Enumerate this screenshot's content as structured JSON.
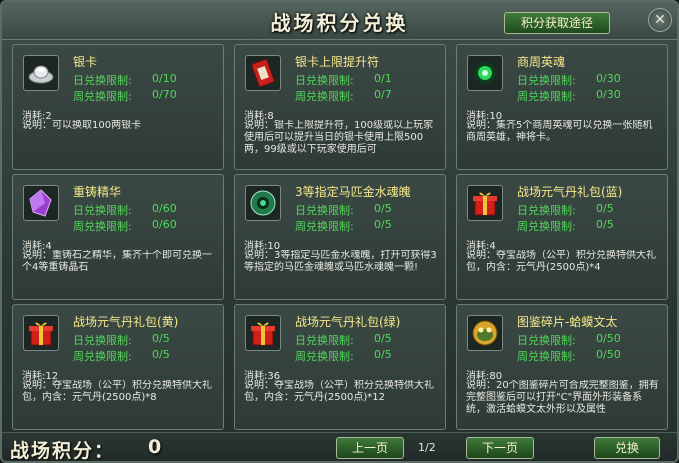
{
  "window": {
    "title": "战场积分兑换",
    "route_button": "积分获取途径",
    "close_glyph": "✕"
  },
  "items": [
    {
      "name": "银卡",
      "icon": "silver-ingot-icon",
      "daily_label": "日兑换限制:",
      "daily_value": "0/10",
      "weekly_label": "周兑换限制:",
      "weekly_value": "0/70",
      "cost": "消耗:2",
      "desc": "说明：可以换取100两银卡"
    },
    {
      "name": "银卡上限提升符",
      "icon": "red-talisman-icon",
      "daily_label": "日兑换限制:",
      "daily_value": "0/1",
      "weekly_label": "周兑换限制:",
      "weekly_value": "0/7",
      "cost": "消耗:8",
      "desc": "说明：银卡上限提升符，100级或以上玩家使用后可以提升当日的银卡使用上限500两，99级或以下玩家使用后可"
    },
    {
      "name": "商周英魂",
      "icon": "green-soul-orb-icon",
      "daily_label": "日兑换限制:",
      "daily_value": "0/30",
      "weekly_label": "周兑换限制:",
      "weekly_value": "0/30",
      "cost": "消耗:10",
      "desc": "说明：集齐5个商周英魂可以兑换一张随机商周英雄，神将卡。"
    },
    {
      "name": "重铸精华",
      "icon": "purple-crystal-icon",
      "daily_label": "日兑换限制:",
      "daily_value": "0/60",
      "weekly_label": "周兑换限制:",
      "weekly_value": "0/60",
      "cost": "消耗:4",
      "desc": "说明：重铸石之精华，集齐十个即可兑换一个4等重铸晶石"
    },
    {
      "name": "3等指定马匹金水魂魄",
      "icon": "jade-disc-icon",
      "daily_label": "日兑换限制:",
      "daily_value": "0/5",
      "weekly_label": "周兑换限制:",
      "weekly_value": "0/5",
      "cost": "消耗:10",
      "desc": "说明：3等指定马匹金水魂魄，打开可获得3等指定的马匹金魂魄或马匹水魂魄一颗!"
    },
    {
      "name": "战场元气丹礼包(蓝)",
      "icon": "gift-box-icon",
      "daily_label": "日兑换限制:",
      "daily_value": "0/5",
      "weekly_label": "周兑换限制:",
      "weekly_value": "0/5",
      "cost": "消耗:4",
      "desc": "说明：夺宝战场（公平）积分兑换特供大礼包，内含：元气丹(2500点)*4"
    },
    {
      "name": "战场元气丹礼包(黄)",
      "icon": "gift-box-icon",
      "daily_label": "日兑换限制:",
      "daily_value": "0/5",
      "weekly_label": "周兑换限制:",
      "weekly_value": "0/5",
      "cost": "消耗:12",
      "desc": "说明：夺宝战场（公平）积分兑换特供大礼包，内含：元气丹(2500点)*8"
    },
    {
      "name": "战场元气丹礼包(绿)",
      "icon": "gift-box-icon",
      "daily_label": "日兑换限制:",
      "daily_value": "0/5",
      "weekly_label": "周兑换限制:",
      "weekly_value": "0/5",
      "cost": "消耗:36",
      "desc": "说明：夺宝战场（公平）积分兑换特供大礼包，内含：元气丹(2500点)*12"
    },
    {
      "name": "图鉴碎片-蛤蟆文太",
      "icon": "toad-fragment-icon",
      "daily_label": "日兑换限制:",
      "daily_value": "0/50",
      "weekly_label": "周兑换限制:",
      "weekly_value": "0/50",
      "cost": "消耗:80",
      "desc": "说明：20个图鉴碎片可合成完整图鉴，拥有完整图鉴后可以打开\"C\"界面外形装备系统，激活蛤蟆文太外形以及属性"
    }
  ],
  "footer": {
    "points_label": "战场积分：",
    "points_value": "0",
    "prev_label": "上一页",
    "page_indicator": "1/2",
    "next_label": "下一页",
    "exchange_label": "兑换"
  }
}
